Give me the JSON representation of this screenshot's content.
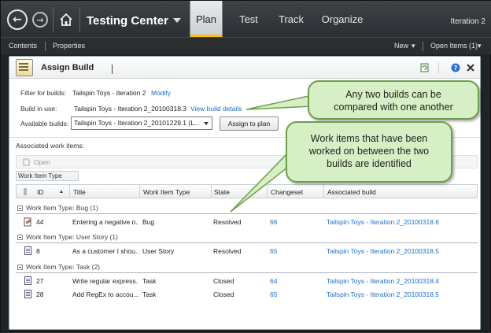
{
  "topbar": {
    "title": "Testing Center",
    "tabs": [
      "Plan",
      "Test",
      "Track",
      "Organize"
    ],
    "iteration": "Iteration 2"
  },
  "navbar": {
    "contents": "Contents",
    "properties": "Properties",
    "new": "New",
    "open_items": "Open Items (1)"
  },
  "panel": {
    "title": "Assign Build",
    "filter_label": "Filter for builds:",
    "filter_value": "Tailspin Toys - Iteration 2",
    "modify": "Modify",
    "build_in_use_label": "Build in use:",
    "build_in_use_value": "Tailspin Toys - Iteration 2_20100318.3",
    "view_build_details": "View build details",
    "available_label": "Available builds:",
    "available_value": "Tailspin Toys - Iteration 2_20101229.1 (L...",
    "assign_button": "Assign to plan",
    "associated_label": "Associated work items:",
    "open": "Open",
    "group_by": "Work Item Type"
  },
  "table": {
    "headers": [
      "ID",
      "Title",
      "Work Item Type",
      "State",
      "Changeset",
      "Associated build"
    ],
    "groups": [
      {
        "label": "Work Item Type: Bug (1)",
        "rows": [
          {
            "id": "44",
            "title": "Entering a negative n...",
            "type": "Bug",
            "state": "Resolved",
            "changeset": "66",
            "build": "Tailspin Toys - Iteration 2_20100318.6"
          }
        ]
      },
      {
        "label": "Work Item Type: User Story (1)",
        "rows": [
          {
            "id": "8",
            "title": "As a customer I shou...",
            "type": "User Story",
            "state": "Resolved",
            "changeset": "65",
            "build": "Tailspin Toys - Iteration 2_20100318.5"
          }
        ]
      },
      {
        "label": "Work Item Type: Task (2)",
        "rows": [
          {
            "id": "27",
            "title": "Write regular express...",
            "type": "Task",
            "state": "Closed",
            "changeset": "64",
            "build": "Tailspin Toys - Iteration 2_20100318.4"
          },
          {
            "id": "28",
            "title": "Add RegEx to accou...",
            "type": "Task",
            "state": "Closed",
            "changeset": "65",
            "build": "Tailspin Toys - Iteration 2_20100318.5"
          }
        ]
      }
    ]
  },
  "callouts": {
    "top": "Any two builds can be compared with one another",
    "bottom": "Work items that have been worked on between the two builds are identified"
  },
  "colors": {
    "accent": "#ffc000",
    "link": "#1a6fc4",
    "callout_fill": "#d6efc4",
    "callout_border": "#6d9f4e"
  }
}
